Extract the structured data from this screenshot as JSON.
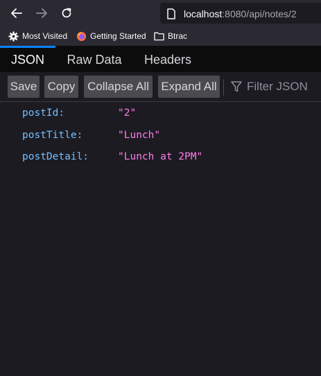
{
  "browser": {
    "url_host": "localhost",
    "url_rest": ":8080/api/notes/2",
    "bookmarks": [
      {
        "label": "Most Visited",
        "icon": "gear-icon"
      },
      {
        "label": "Getting Started",
        "icon": "firefox-icon"
      },
      {
        "label": "Btrac",
        "icon": "folder-icon"
      }
    ]
  },
  "viewer": {
    "tabs": [
      {
        "label": "JSON",
        "active": true
      },
      {
        "label": "Raw Data",
        "active": false
      },
      {
        "label": "Headers",
        "active": false
      }
    ],
    "toolbar": {
      "save_label": "Save",
      "copy_label": "Copy",
      "collapse_label": "Collapse All",
      "expand_label": "Expand All",
      "filter_placeholder": "Filter JSON"
    },
    "rows": [
      {
        "key": "postId:",
        "value": "\"2\""
      },
      {
        "key": "postTitle:",
        "value": "\"Lunch\""
      },
      {
        "key": "postDetail:",
        "value": "\"Lunch at 2PM\""
      }
    ]
  },
  "colors": {
    "accent": "#0a84ff",
    "key": "#75bfff",
    "string_value": "#ff7de9",
    "background": "#1c1b22"
  }
}
